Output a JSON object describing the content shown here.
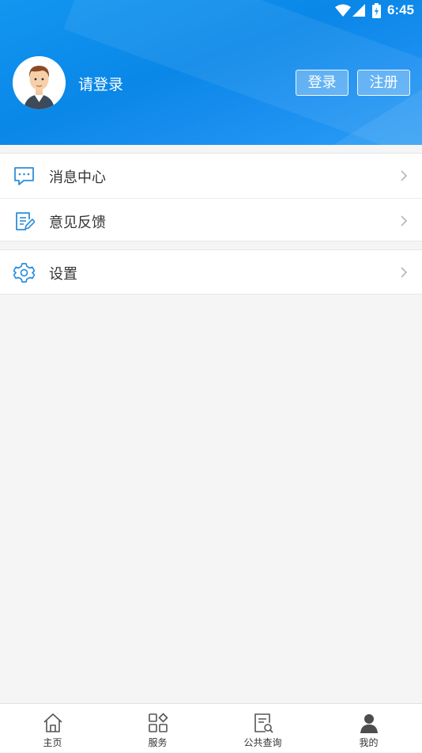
{
  "status_bar": {
    "time": "6:45"
  },
  "header": {
    "login_prompt": "请登录",
    "login_button": "登录",
    "register_button": "注册"
  },
  "menu": {
    "group1": [
      {
        "label": "消息中心",
        "icon": "message-icon"
      },
      {
        "label": "意见反馈",
        "icon": "feedback-icon"
      }
    ],
    "group2": [
      {
        "label": "设置",
        "icon": "gear-icon"
      }
    ]
  },
  "tabbar": [
    {
      "label": "主页",
      "icon": "home-icon"
    },
    {
      "label": "服务",
      "icon": "grid-icon"
    },
    {
      "label": "公共查询",
      "icon": "search-document-icon"
    },
    {
      "label": "我的",
      "icon": "person-icon",
      "active": true
    }
  ],
  "colors": {
    "accent": "#0a87e8",
    "icon_blue": "#2b8fdc"
  }
}
